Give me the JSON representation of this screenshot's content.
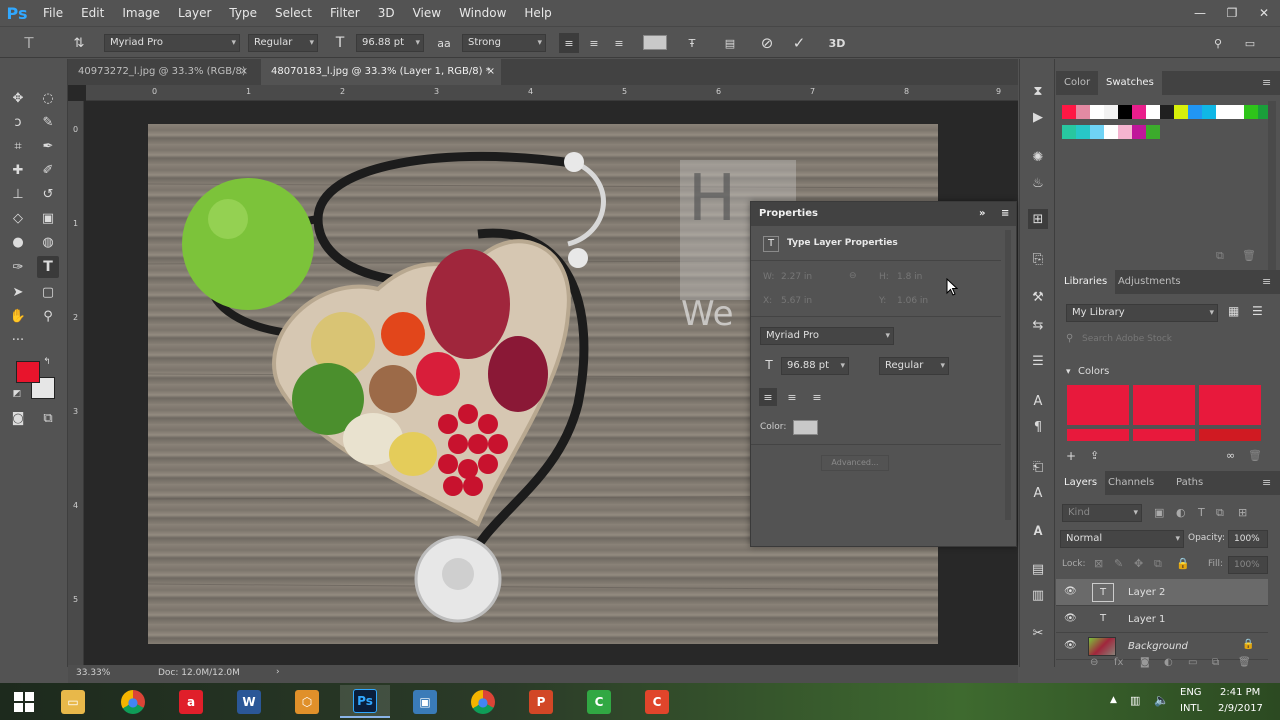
{
  "app": {
    "logo": "Ps"
  },
  "menu": [
    "File",
    "Edit",
    "Image",
    "Layer",
    "Type",
    "Select",
    "Filter",
    "3D",
    "View",
    "Window",
    "Help"
  ],
  "window_controls": {
    "minimize": "—",
    "restore": "❐",
    "close": "✕"
  },
  "options": {
    "font_family": "Myriad Pro",
    "font_style": "Regular",
    "font_size": "96.88 pt",
    "anti_alias": "Strong",
    "threed_label": "3D"
  },
  "tabs": [
    {
      "label": "40973272_l.jpg @ 33.3% (RGB/8)",
      "close": "×"
    },
    {
      "label": "48070183_l.jpg @ 33.3% (Layer 1, RGB/8) *",
      "close": "×"
    }
  ],
  "rulers": {
    "h": [
      "0",
      "1",
      "2",
      "3",
      "4",
      "5",
      "6",
      "7",
      "8",
      "9"
    ],
    "v": [
      "0",
      "1",
      "2",
      "3",
      "4",
      "5"
    ]
  },
  "canvas_text": {
    "letter": "H",
    "word": "We"
  },
  "status": {
    "zoom": "33.33%",
    "doc": "Doc: 12.0M/12.0M"
  },
  "properties": {
    "title": "Properties",
    "subtitle": "Type Layer Properties",
    "w_label": "W:",
    "w_value": "2.27 in",
    "h_label": "H:",
    "h_value": "1.8 in",
    "x_label": "X:",
    "x_value": "5.67 in",
    "y_label": "Y:",
    "y_value": "1.06 in",
    "font_family": "Myriad Pro",
    "font_size": "96.88 pt",
    "font_style": "Regular",
    "color_label": "Color:",
    "advanced": "Advanced..."
  },
  "color_panel": {
    "tabs": [
      "Color",
      "Swatches"
    ],
    "active": "Swatches"
  },
  "swatches_row1": [
    "#ff1744",
    "#e38aa3",
    "#ffffff",
    "#f2f2f2",
    "#000000",
    "#e91e8c",
    "#ffffff",
    "#202020",
    "#d7f00a",
    "#2196f3",
    "#10b7e6",
    "#ffffff",
    "#ffffff",
    "#2ec41a",
    "#1a9e3a"
  ],
  "swatches_row2": [
    "#28c7a0",
    "#28c7c7",
    "#6fd3f5",
    "#ffffff",
    "#f5b4d0",
    "#c0169a",
    "#3cab2c"
  ],
  "libraries": {
    "tabs": [
      "Libraries",
      "Adjustments"
    ],
    "library": "My Library",
    "search_placeholder": "Search Adobe Stock",
    "colors_label": "Colors",
    "color_tiles": [
      "#e8193c",
      "#e8193c",
      "#e8193c",
      "#e8193c",
      "#e8193c",
      "#d01a22"
    ]
  },
  "layers_panel": {
    "tabs": [
      "Layers",
      "Channels",
      "Paths"
    ],
    "kind": "Kind",
    "blend": "Normal",
    "opacity_label": "Opacity:",
    "opacity": "100%",
    "lock_label": "Lock:",
    "fill_label": "Fill:",
    "fill": "100%",
    "layers": [
      {
        "name": "Layer 2",
        "type": "text",
        "selected": true
      },
      {
        "name": "Layer 1",
        "type": "text",
        "selected": false
      },
      {
        "name": "Background",
        "type": "image",
        "selected": false
      }
    ]
  },
  "foreground_color": "#e8142c",
  "background_color": "#e6e6e6",
  "taskbar": {
    "apps": [
      {
        "name": "file-explorer",
        "glyph": "▭",
        "color": "#e8b84a"
      },
      {
        "name": "chrome",
        "glyph": "●",
        "color": "#ffffff"
      },
      {
        "name": "airtel",
        "glyph": "a",
        "color": "#e01f2a"
      },
      {
        "name": "word",
        "glyph": "W",
        "color": "#2b5797"
      },
      {
        "name": "basket",
        "glyph": "⬡",
        "color": "#e0902a"
      },
      {
        "name": "photoshop",
        "glyph": "Ps",
        "color": "#0a1e3c"
      },
      {
        "name": "photos",
        "glyph": "▣",
        "color": "#3a7bb8"
      },
      {
        "name": "chrome-2",
        "glyph": "●",
        "color": "#ffffff"
      },
      {
        "name": "powerpoint",
        "glyph": "P",
        "color": "#d24726"
      },
      {
        "name": "camtasia-green",
        "glyph": "C",
        "color": "#31a843"
      },
      {
        "name": "camtasia-red",
        "glyph": "C",
        "color": "#e0452b"
      }
    ],
    "lang_top": "ENG",
    "lang_bottom": "INTL",
    "time": "2:41 PM",
    "date": "2/9/2017"
  }
}
